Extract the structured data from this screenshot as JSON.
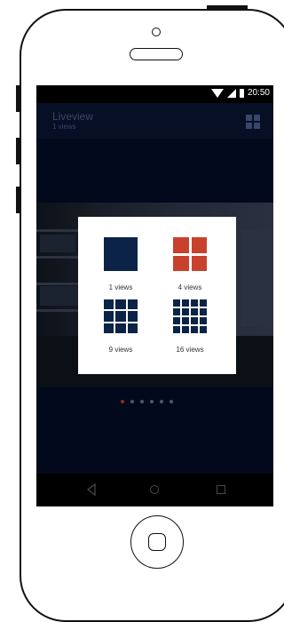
{
  "status_bar": {
    "time": "20:50"
  },
  "app_bar": {
    "title": "Liveview",
    "subtitle": "1 views"
  },
  "layout_dialog": {
    "options": [
      {
        "label": "1 views",
        "grid": 1,
        "color": "#0b2347"
      },
      {
        "label": "4 views",
        "grid": 2,
        "color": "#c8412c",
        "selected": true
      },
      {
        "label": "9 views",
        "grid": 3,
        "color": "#0b2347"
      },
      {
        "label": "16 views",
        "grid": 4,
        "color": "#0b2347"
      }
    ]
  },
  "pager": {
    "count": 6,
    "active_index": 0
  },
  "colors": {
    "accent": "#c8412c",
    "tile": "#0b2347",
    "screen_bg": "#03091d"
  }
}
